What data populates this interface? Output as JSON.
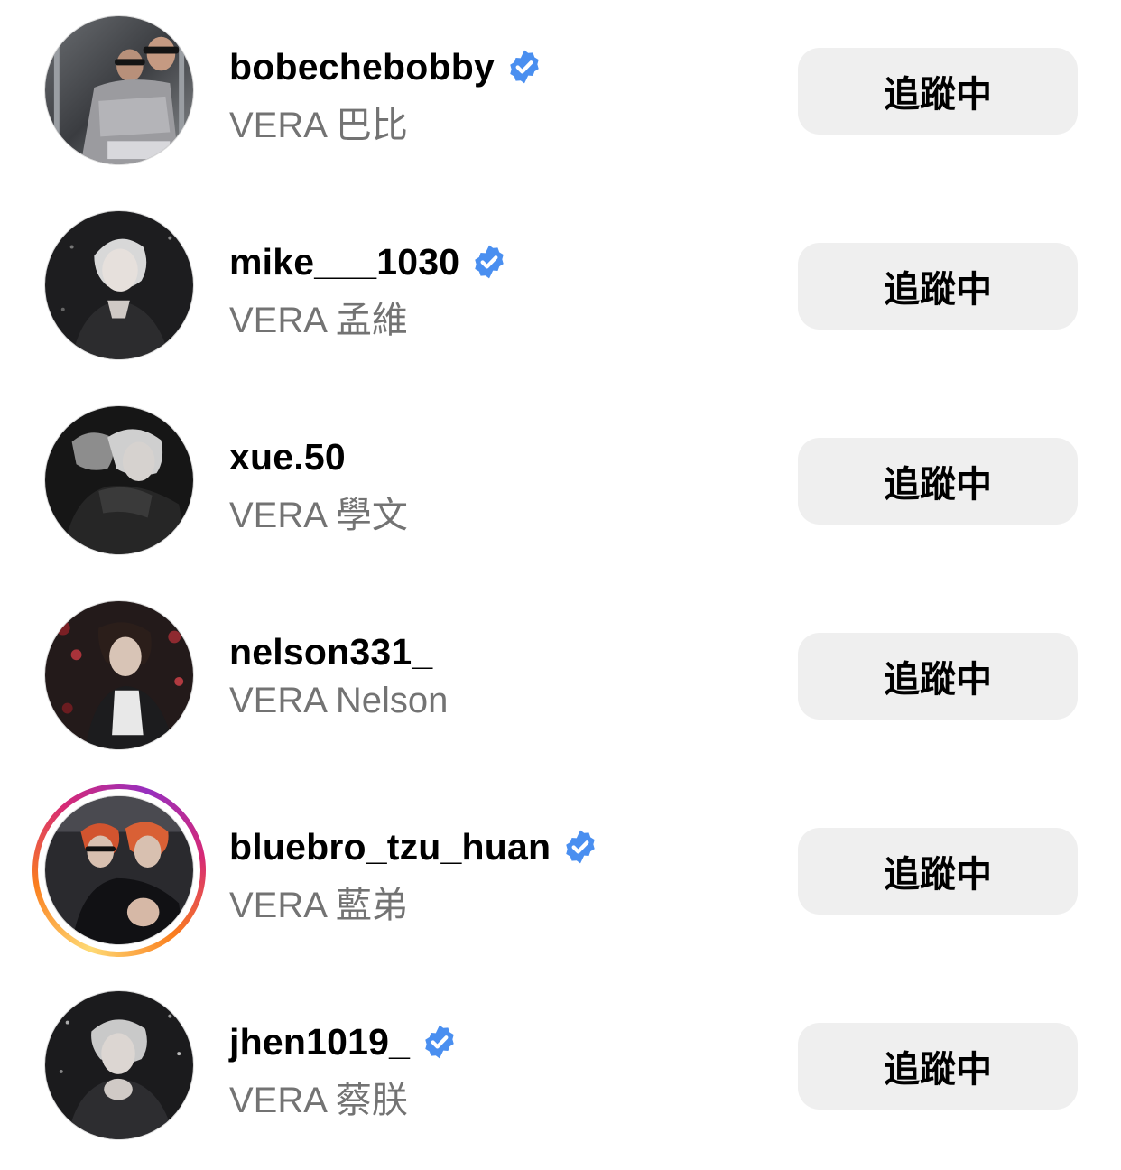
{
  "follow_list": {
    "verified_icon_color": "#4a8ff0",
    "button_color": "#efefef",
    "items": [
      {
        "username": "bobechebobby",
        "full_name": "VERA 巴比",
        "verified": true,
        "has_story": false,
        "button_label": "追蹤中",
        "avatar_icon": "profile-photo"
      },
      {
        "username": "mike___1030",
        "full_name": "VERA 孟維",
        "verified": true,
        "has_story": false,
        "button_label": "追蹤中",
        "avatar_icon": "profile-photo"
      },
      {
        "username": "xue.50",
        "full_name": "VERA 學文",
        "verified": false,
        "has_story": false,
        "button_label": "追蹤中",
        "avatar_icon": "profile-photo"
      },
      {
        "username": "nelson331_",
        "full_name": "VERA Nelson",
        "verified": false,
        "has_story": false,
        "button_label": "追蹤中",
        "avatar_icon": "profile-photo"
      },
      {
        "username": "bluebro_tzu_huan",
        "full_name": "VERA 藍弟",
        "verified": true,
        "has_story": true,
        "button_label": "追蹤中",
        "avatar_icon": "profile-photo"
      },
      {
        "username": "jhen1019_",
        "full_name": "VERA 蔡朕",
        "verified": true,
        "has_story": false,
        "button_label": "追蹤中",
        "avatar_icon": "profile-photo"
      }
    ]
  }
}
